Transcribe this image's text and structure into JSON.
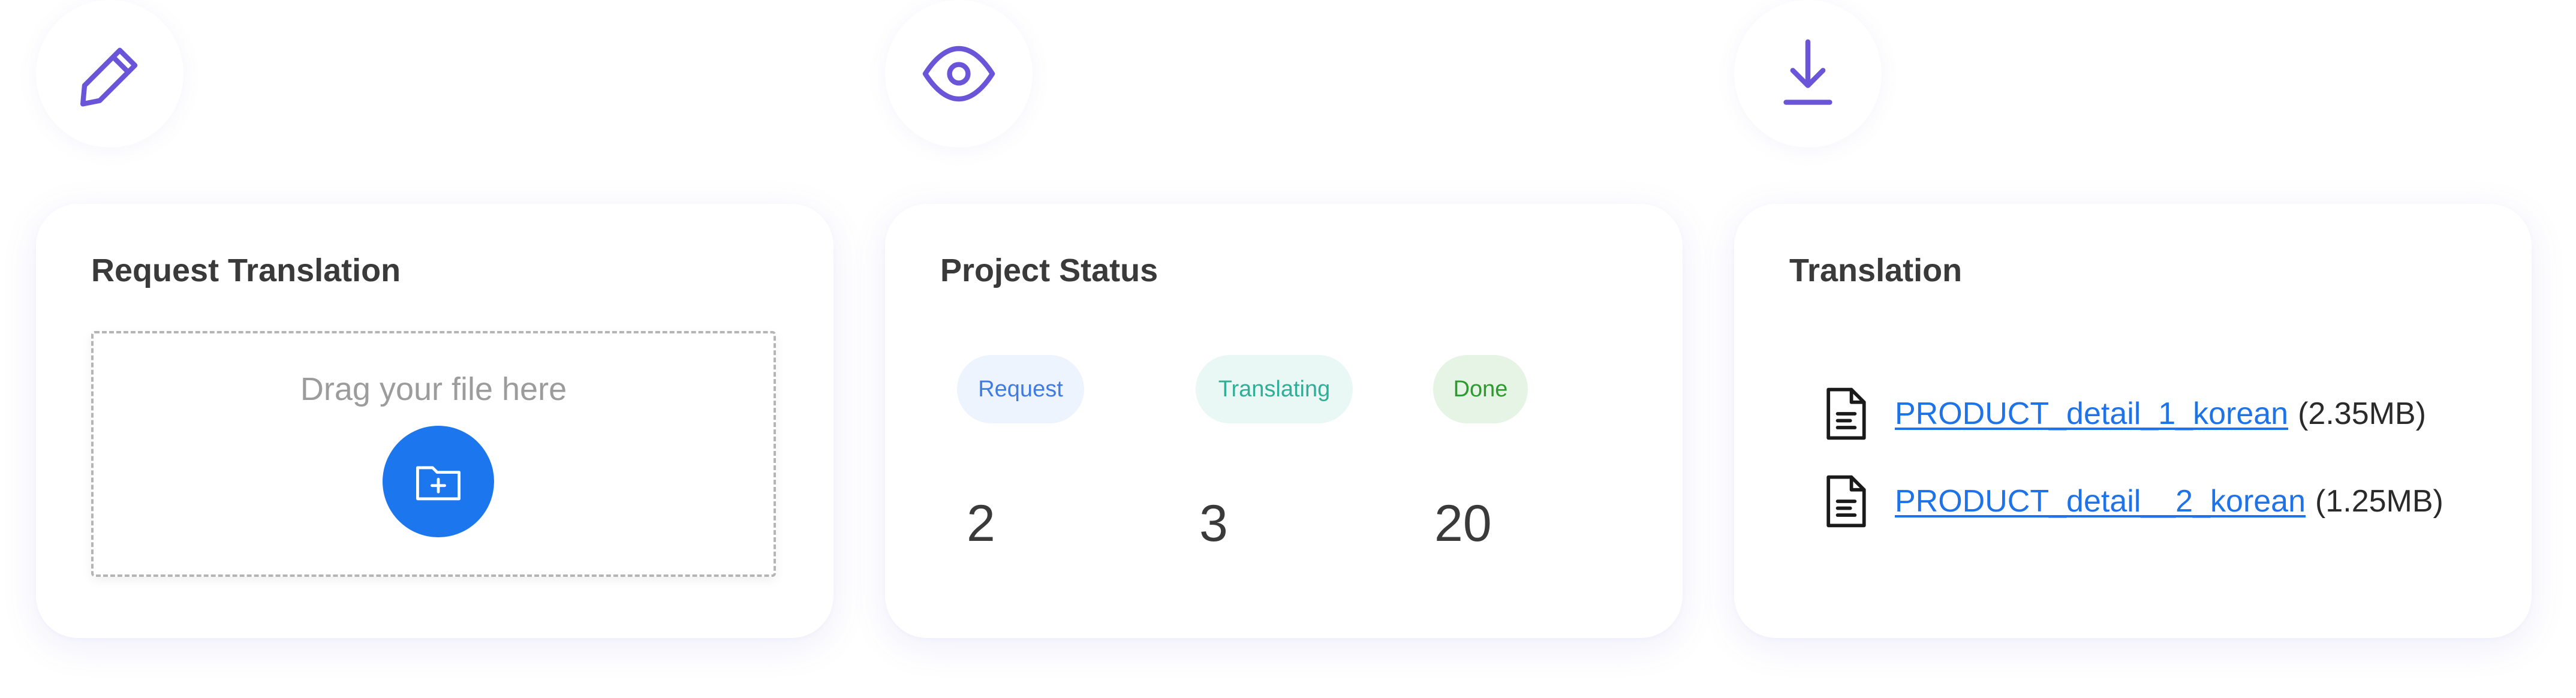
{
  "colors": {
    "icon_accent": "#6a55d8",
    "link_blue": "#1f73e8",
    "upload_button_blue": "#1c77ee",
    "request_badge_text": "#3f7be3",
    "translating_badge_text": "#32ad97",
    "done_badge_text": "#2d9a2d"
  },
  "request": {
    "icon": "pencil-icon",
    "title": "Request Translation",
    "dropzone_text": "Drag your file here",
    "upload_icon": "folder-plus-icon"
  },
  "status": {
    "icon": "eye-icon",
    "title": "Project Status",
    "items": [
      {
        "label": "Request",
        "count": "2"
      },
      {
        "label": "Translating",
        "count": "3"
      },
      {
        "label": "Done",
        "count": "20"
      }
    ]
  },
  "translation": {
    "icon": "download-icon",
    "title": "Translation",
    "files": [
      {
        "icon": "document-icon",
        "name": "PRODUCT_detail_1_korean",
        "size": "(2.35MB)"
      },
      {
        "icon": "document-icon",
        "name": "PRODUCT_detail__2_korean",
        "size": "(1.25MB)"
      }
    ]
  }
}
